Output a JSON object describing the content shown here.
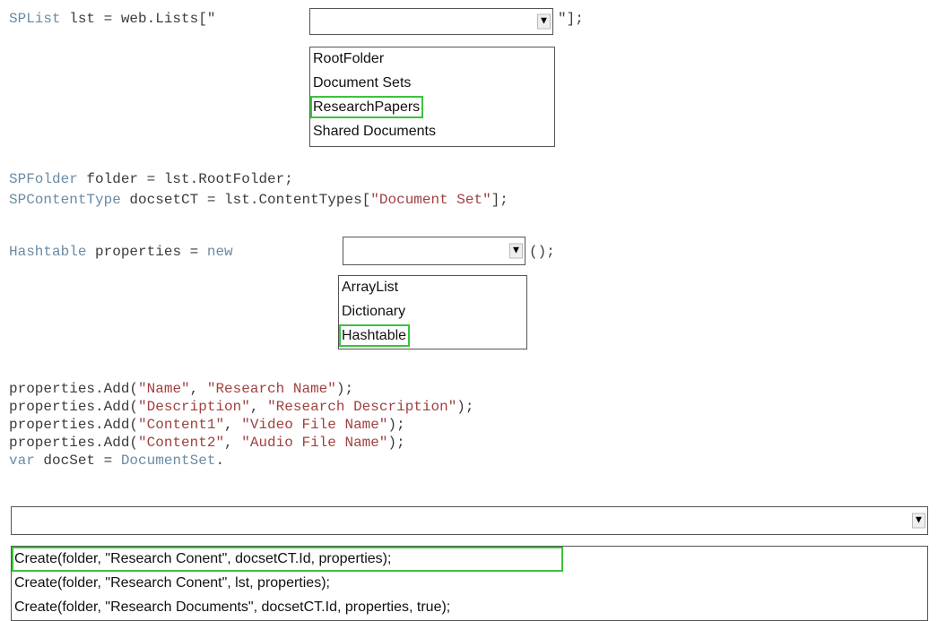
{
  "line1": {
    "type": "SPList",
    "code_mid": " lst = web.Lists[\"",
    "code_end": "\"];"
  },
  "combo1": {
    "selected": "",
    "options": [
      "RootFolder",
      "Document Sets",
      "ResearchPapers",
      "Shared Documents"
    ],
    "highlighted_index": 2
  },
  "line2": {
    "type": "SPFolder",
    "code": " folder = lst.RootFolder;"
  },
  "line3": {
    "type": "SPContentType",
    "code_mid": " docsetCT = lst.ContentTypes[",
    "string": "\"Document Set\"",
    "code_end": "];"
  },
  "line4": {
    "type": "Hashtable",
    "code_mid": " properties = ",
    "keyword": "new",
    "code_end": "();"
  },
  "combo2": {
    "selected": "",
    "options": [
      "ArrayList",
      "Dictionary",
      "Hashtable"
    ],
    "highlighted_index": 2
  },
  "props": [
    {
      "pre": "properties.Add(",
      "k": "\"Name\"",
      "sep": ", ",
      "v": "\"Research Name\"",
      "post": ");"
    },
    {
      "pre": "properties.Add(",
      "k": "\"Description\"",
      "sep": ", ",
      "v": "\"Research Description\"",
      "post": ");"
    },
    {
      "pre": "properties.Add(",
      "k": "\"Content1\"",
      "sep": ", ",
      "v": "\"Video File Name\"",
      "post": ");"
    },
    {
      "pre": "properties.Add(",
      "k": "\"Content2\"",
      "sep": ", ",
      "v": "\"Audio File Name\"",
      "post": ");"
    }
  ],
  "line_var": {
    "keyword": "var",
    "code_mid": " docSet = ",
    "type": "DocumentSet",
    "code_end": "."
  },
  "combo3": {
    "selected": "",
    "options": [
      "Create(folder, \"Research Conent\", docsetCT.Id, properties);",
      "Create(folder, \"Research Conent\", lst, properties);",
      "Create(folder, \"Research Documents\", docsetCT.Id, properties, true);"
    ],
    "highlighted_index": 0
  },
  "colors": {
    "highlight": "#3cc23c",
    "type": "#6a8ca3",
    "string": "#a0413f"
  },
  "icons": {
    "dropdown": "chevron-down-icon"
  }
}
